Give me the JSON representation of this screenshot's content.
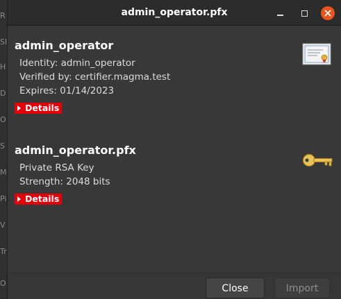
{
  "background_window": {
    "side_letters": [
      "R",
      "SI",
      "H",
      "D",
      "O",
      "S",
      "M",
      "Pi",
      "V",
      "Tr",
      "O"
    ]
  },
  "dialog": {
    "title": "admin_operator.pfx",
    "window_controls": {
      "minimize_icon": "minimize-icon",
      "maximize_icon": "maximize-icon",
      "close_icon": "close-icon",
      "close_color": "#e95420"
    },
    "items": [
      {
        "title": "admin_operator",
        "lines": [
          "Identity: admin_operator",
          "Verified by: certifier.magma.test",
          "Expires: 01/14/2023"
        ],
        "details_label": "Details",
        "icon": "certificate-icon"
      },
      {
        "title": "admin_operator.pfx",
        "lines": [
          "Private RSA Key",
          "Strength: 2048 bits"
        ],
        "details_label": "Details",
        "icon": "key-icon"
      }
    ],
    "details_color": "#e3000b",
    "buttons": {
      "close_label": "Close",
      "import_label": "Import"
    }
  }
}
